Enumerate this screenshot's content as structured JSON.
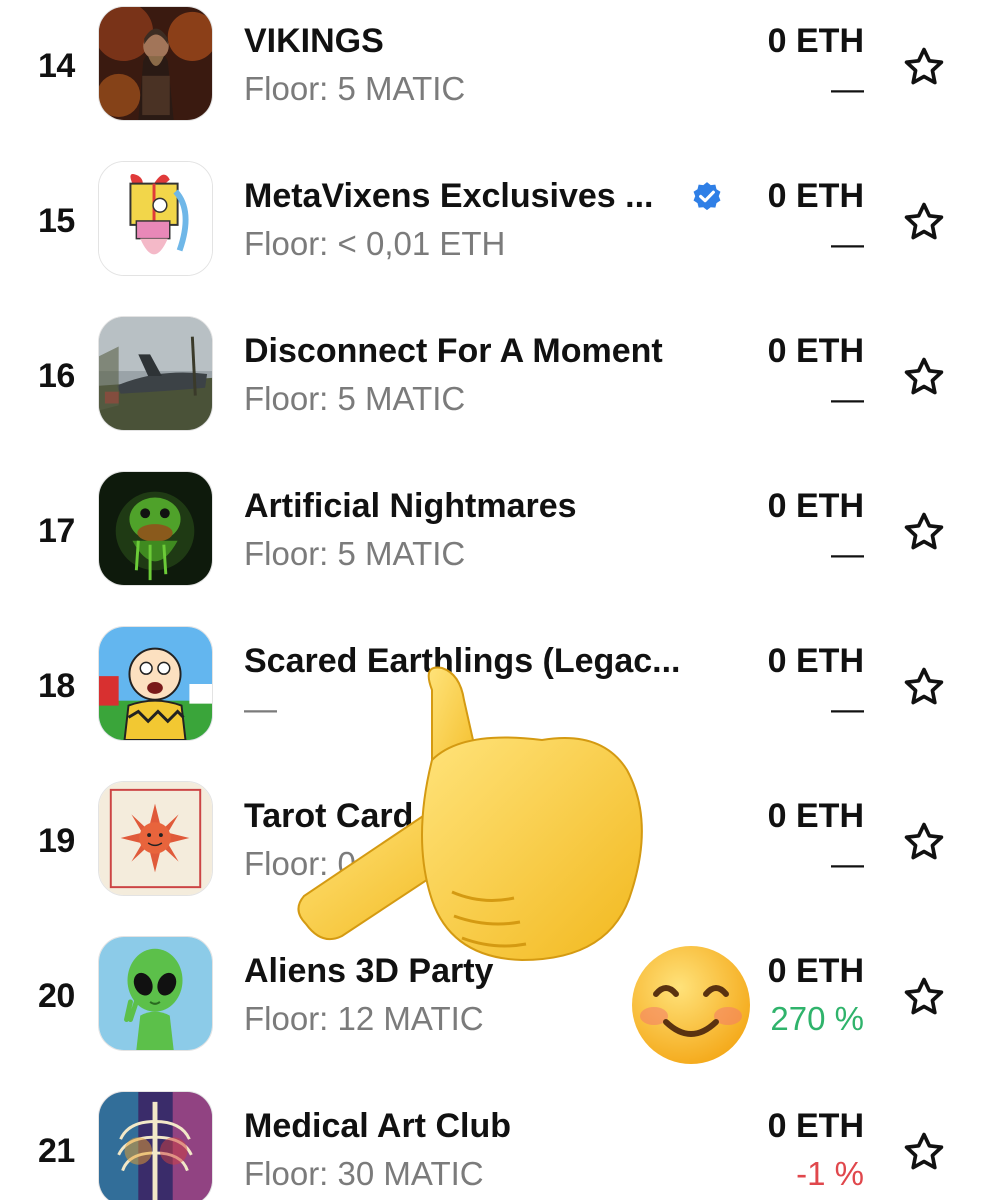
{
  "collections": [
    {
      "rank": "14",
      "name": "VIKINGS",
      "floor": "Floor: 5 MATIC",
      "volume": "0 ETH",
      "change": "—",
      "change_trend": "none",
      "verified": false,
      "thumb_icon": "viking-warrior-image"
    },
    {
      "rank": "15",
      "name": "MetaVixens Exclusives ...",
      "floor": "Floor: < 0,01 ETH",
      "volume": "0 ETH",
      "change": "—",
      "change_trend": "none",
      "verified": true,
      "thumb_icon": "cartoon-gift-girl-image"
    },
    {
      "rank": "16",
      "name": "Disconnect For A Moment",
      "floor": "Floor: 5 MATIC",
      "volume": "0 ETH",
      "change": "—",
      "change_trend": "none",
      "verified": false,
      "thumb_icon": "abandoned-airplane-image"
    },
    {
      "rank": "17",
      "name": "Artificial Nightmares",
      "floor": "Floor: 5 MATIC",
      "volume": "0 ETH",
      "change": "—",
      "change_trend": "none",
      "verified": false,
      "thumb_icon": "green-slime-duck-image"
    },
    {
      "rank": "18",
      "name": "Scared Earthlings (Legac...",
      "floor": "—",
      "volume": "0 ETH",
      "change": "—",
      "change_trend": "none",
      "verified": false,
      "thumb_icon": "scared-cartoon-boy-image"
    },
    {
      "rank": "19",
      "name": "Tarot Card",
      "floor": "Floor: 0",
      "volume": "0 ETH",
      "change": "—",
      "change_trend": "none",
      "verified": false,
      "thumb_icon": "tarot-sun-card-image"
    },
    {
      "rank": "20",
      "name": "Aliens 3D Party",
      "floor": "Floor: 12 MATIC",
      "volume": "0 ETH",
      "change": "270 %",
      "change_trend": "up",
      "verified": false,
      "thumb_icon": "green-alien-image"
    },
    {
      "rank": "21",
      "name": "Medical Art Club",
      "floor": "Floor: 30 MATIC",
      "volume": "0 ETH",
      "change": "-1 %",
      "change_trend": "down",
      "verified": false,
      "thumb_icon": "xray-chest-art-image"
    }
  ],
  "icons": {
    "favorite": "star-outline-icon",
    "verified": "verified-badge-icon",
    "overlay_hand": "pointing-hand-emoji",
    "overlay_face": "smiling-face-emoji"
  },
  "colors": {
    "text": "#111111",
    "muted": "#7b7b7b",
    "positive": "#2fb36b",
    "negative": "#e0474c",
    "verified": "#2f7fe6"
  }
}
